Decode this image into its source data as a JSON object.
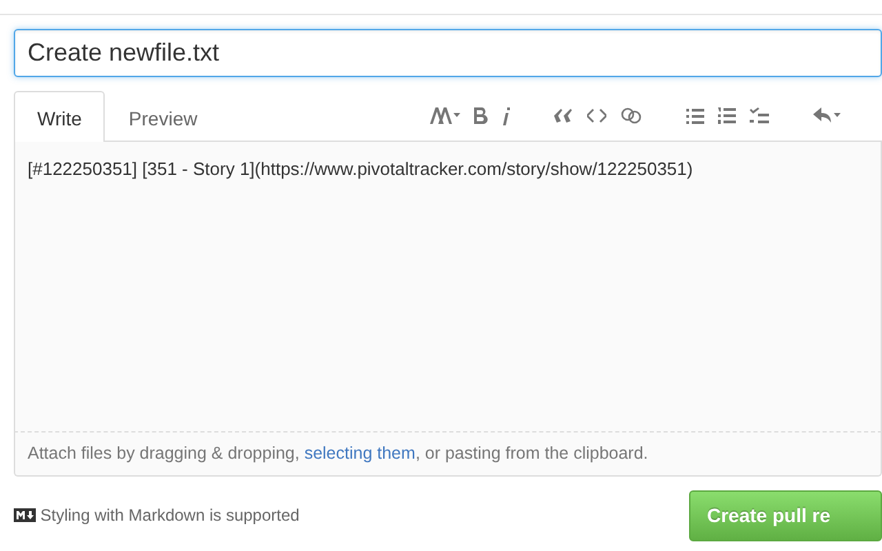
{
  "title_field": {
    "value": "Create newfile.txt"
  },
  "tabs": [
    {
      "label": "Write",
      "selected": true
    },
    {
      "label": "Preview",
      "selected": false
    }
  ],
  "editor": {
    "value": "[#122250351] [351 - Story 1](https://www.pivotaltracker.com/story/show/122250351)"
  },
  "attach_hint": {
    "before": "Attach files by dragging & dropping, ",
    "link": "selecting them",
    "after": ", or pasting from the clipboard."
  },
  "markdown_note": "Styling with Markdown is supported",
  "submit_button": "Create pull re"
}
